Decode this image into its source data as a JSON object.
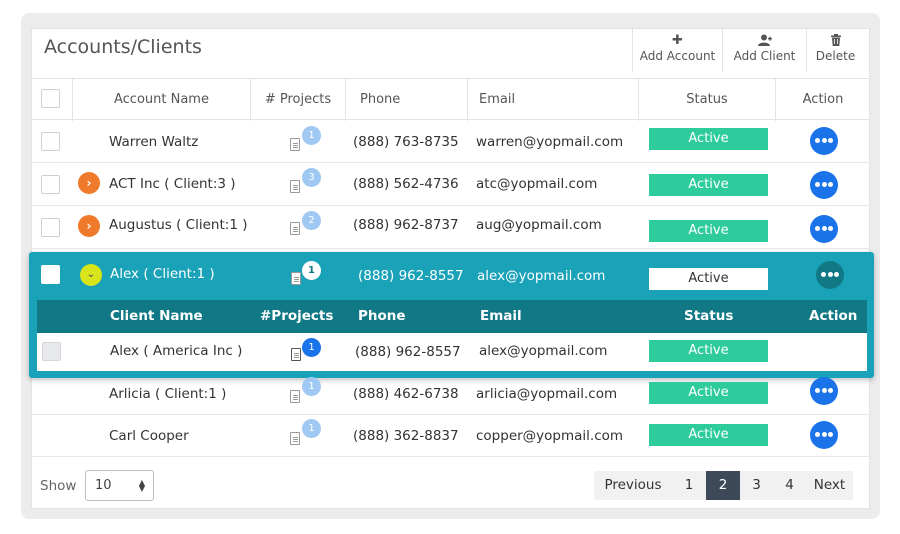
{
  "page": {
    "title": "Accounts/Clients"
  },
  "toolbar": {
    "add_account": {
      "label": "Add Account",
      "icon": "plus-icon"
    },
    "add_client": {
      "label": "Add Client",
      "icon": "user-plus-icon"
    },
    "delete": {
      "label": "Delete",
      "icon": "trash-icon"
    }
  },
  "table": {
    "headers": {
      "account_name": "Account Name",
      "projects": "# Projects",
      "phone": "Phone",
      "email": "Email",
      "status": "Status",
      "action": "Action"
    },
    "rows": [
      {
        "name": "Warren Waltz",
        "projects": "1",
        "phone": "(888) 763-8735",
        "email": "warren@yopmail.com",
        "status": "Active",
        "expandable": false
      },
      {
        "name": "ACT Inc ( Client:3 )",
        "projects": "3",
        "phone": "(888) 562-4736",
        "email": "atc@yopmail.com",
        "status": "Active",
        "expandable": true
      },
      {
        "name": "Augustus ( Client:1 )",
        "projects": "2",
        "phone": "(888) 962-8737",
        "email": "aug@yopmail.com",
        "status": "Active",
        "expandable": true
      },
      {
        "name": "Alex ( Client:1 )",
        "projects": "1",
        "phone": "(888) 962-8557",
        "email": "alex@yopmail.com",
        "status": "Active",
        "expanded": true
      },
      {
        "name": "Arlicia ( Client:1 )",
        "projects": "1",
        "phone": "(888) 462-6738",
        "email": "arlicia@yopmail.com",
        "status": "Active",
        "expandable": false
      },
      {
        "name": "Carl Cooper",
        "projects": "1",
        "phone": "(888) 362-8837",
        "email": "copper@yopmail.com",
        "status": "Active",
        "expandable": false
      }
    ],
    "sub_table": {
      "headers": {
        "client_name": "Client Name",
        "projects": "#Projects",
        "phone": "Phone",
        "email": "Email",
        "status": "Status",
        "action": "Action"
      },
      "rows": [
        {
          "name": "Alex ( America Inc  )",
          "projects": "1",
          "phone": "(888) 962-8557",
          "email": "alex@yopmail.com",
          "status": "Active"
        }
      ]
    }
  },
  "footer": {
    "show_label": "Show",
    "page_size": "10",
    "pagination": {
      "previous": "Previous",
      "pages": [
        "1",
        "2",
        "3",
        "4"
      ],
      "current": "2",
      "next": "Next"
    }
  },
  "colors": {
    "status_active": "#2ecc9c",
    "action_button": "#1a73e8",
    "expanded_row": "#19a2b8",
    "sub_header": "#117986",
    "expander": "#f07a2b",
    "expander_open": "#d7e51a",
    "pagination_active": "#3d4858"
  }
}
